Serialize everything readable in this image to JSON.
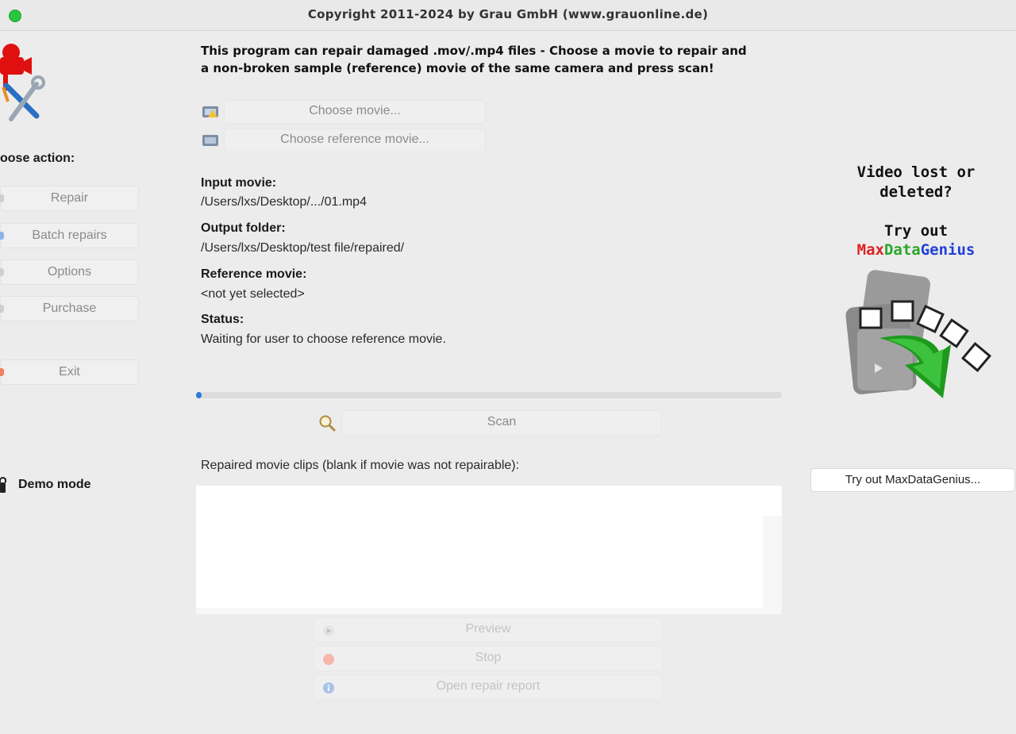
{
  "window": {
    "title": "Copyright 2011-2024 by Grau GmbH (www.grauonline.de)"
  },
  "sidebar": {
    "heading": "oose action:",
    "buttons": [
      "Repair",
      "Batch repairs",
      "Options",
      "Purchase",
      "Exit"
    ],
    "mode": "Demo mode"
  },
  "main": {
    "intro_line1": "This program can repair damaged .mov/.mp4 files - Choose a movie to repair and",
    "intro_line2": "a non-broken sample (reference) movie of the same camera and press scan!",
    "choose_movie": "Choose movie...",
    "choose_reference": "Choose reference movie...",
    "fields": [
      {
        "label": "Input movie:",
        "value": "/Users/lxs/Desktop/.../01.mp4"
      },
      {
        "label": "Output folder:",
        "value": "/Users/lxs/Desktop/test file/repaired/"
      },
      {
        "label": "Reference movie:",
        "value": "<not yet selected>"
      },
      {
        "label": "Status:",
        "value": "Waiting for user to choose reference movie."
      }
    ],
    "progress": 0.01,
    "scan": "Scan",
    "clips_label": "Repaired movie clips (blank if movie was not repairable):",
    "preview": "Preview",
    "stop": "Stop",
    "open_report": "Open repair report"
  },
  "promo": {
    "line1": "Video lost or",
    "line2": "deleted?",
    "line3": "Try out",
    "brand_max": "Max",
    "brand_data": "Data",
    "brand_genius": "Genius",
    "button": "Try out MaxDataGenius...",
    "colors": {
      "max": "#e02020",
      "data": "#2aa62a",
      "genius": "#2040d8"
    }
  },
  "icons": [
    "app-logo-icon",
    "film-icon",
    "search-icon",
    "play-icon",
    "stop-icon",
    "info-icon",
    "lock-icon",
    "maxdatagenius-promo-icon"
  ]
}
